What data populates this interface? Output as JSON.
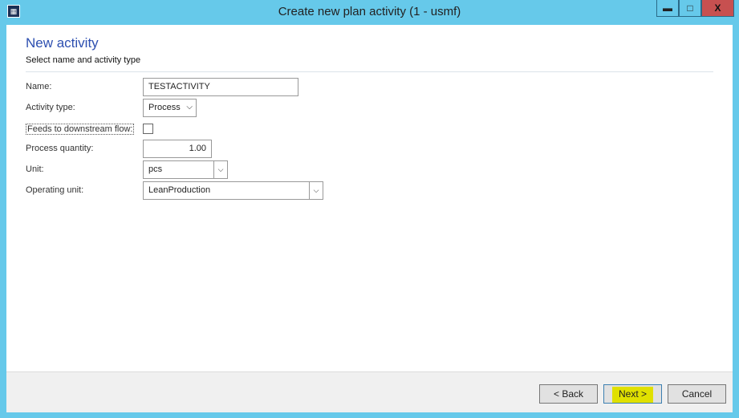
{
  "window": {
    "title": "Create new plan activity (1 - usmf)",
    "minimize": "▬",
    "maximize": "□",
    "close": "X"
  },
  "header": {
    "title": "New activity",
    "subtitle": "Select name and activity type"
  },
  "form": {
    "name": {
      "label": "Name:",
      "value": "TESTACTIVITY"
    },
    "activity_type": {
      "label": "Activity type:",
      "value": "Process"
    },
    "feeds": {
      "label": "Feeds to downstream flow:",
      "checked": false
    },
    "process_quantity": {
      "label": "Process quantity:",
      "value": "1.00"
    },
    "unit": {
      "label": "Unit:",
      "value": "pcs"
    },
    "operating_unit": {
      "label": "Operating unit:",
      "value": "LeanProduction"
    }
  },
  "footer": {
    "back": "< Back",
    "next": "Next >",
    "cancel": "Cancel"
  },
  "colors": {
    "titlebar": "#66c9ea",
    "close": "#c75050",
    "heading": "#2d4fb0",
    "highlight": "#e0e000"
  }
}
